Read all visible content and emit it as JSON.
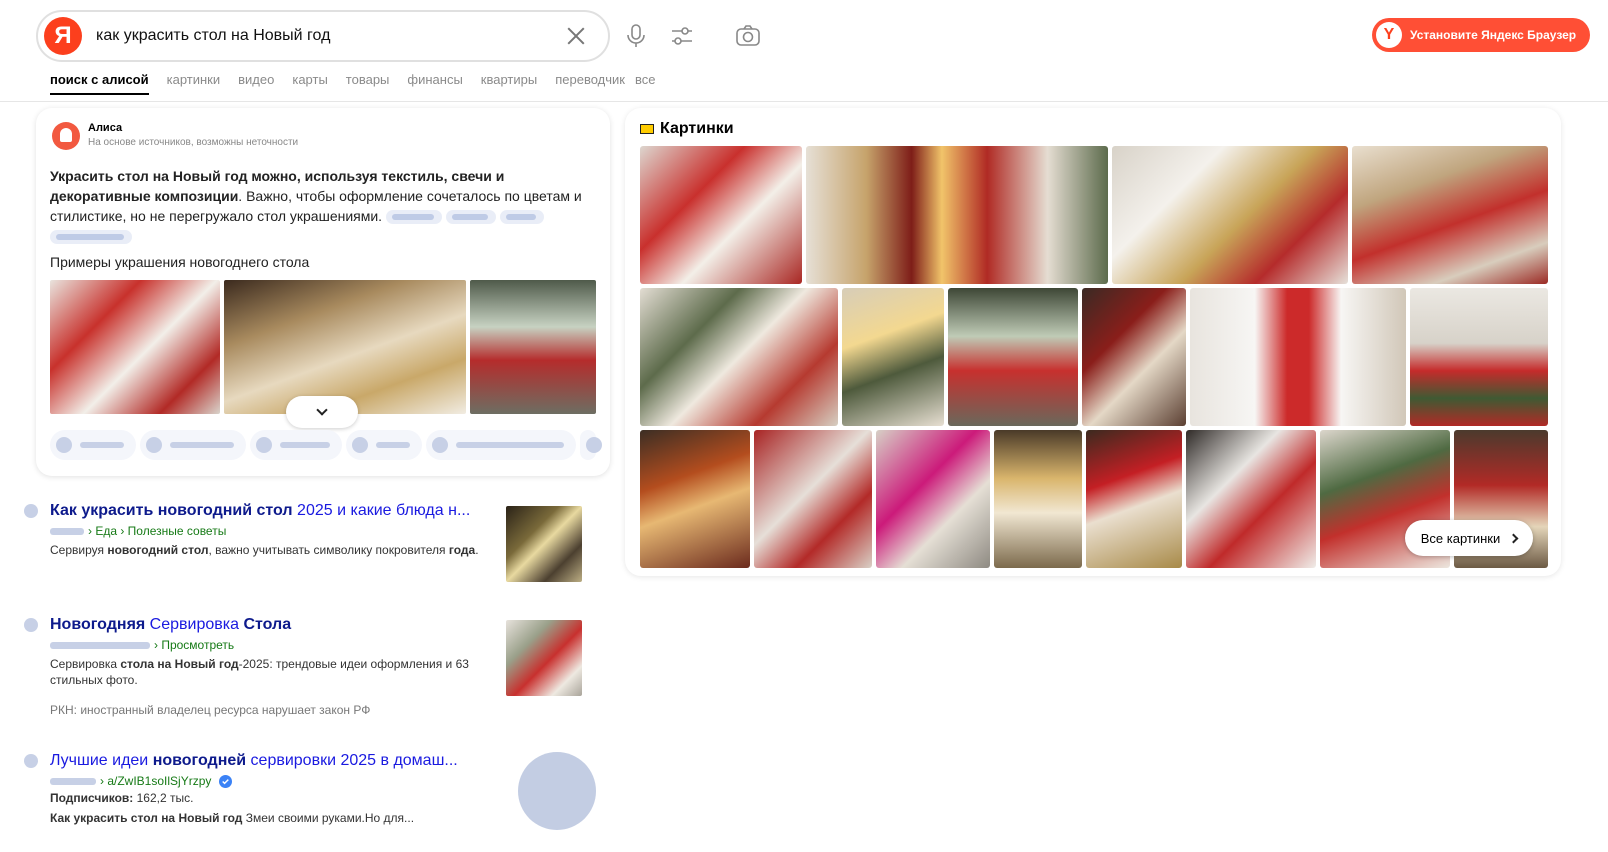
{
  "search": {
    "query": "как украсить стол на Новый год",
    "logo_letter": "Я"
  },
  "header": {
    "install_label": "Установите Яндекс Браузер",
    "install_logo": "Y"
  },
  "tabs": [
    "поиск с алисой",
    "картинки",
    "видео",
    "карты",
    "товары",
    "финансы",
    "квартиры",
    "переводчик",
    "все"
  ],
  "alice": {
    "name": "Алиса",
    "subtitle": "На основе источников, возможны неточности",
    "answer_bold": "Украсить стол на Новый год можно, используя текстиль, свечи и декоративные композиции",
    "answer_rest": ". Важно, чтобы оформление сочеталось по цветам и стилистике, но не перегружало стол украшениями.",
    "examples_title": "Примеры украшения новогоднего стола"
  },
  "results": [
    {
      "title_parts": [
        [
          "b",
          "Как украсить новогодний стол"
        ],
        [
          "t",
          " 2025 и какие блюда н..."
        ]
      ],
      "url": "› Еда › Полезные советы",
      "snippet_parts": [
        [
          "t",
          "Сервируя "
        ],
        [
          "b",
          "новогодний стол"
        ],
        [
          "t",
          ", важно учитывать символику покровителя "
        ],
        [
          "b",
          "года"
        ],
        [
          "t",
          "."
        ]
      ]
    },
    {
      "title_parts": [
        [
          "b",
          "Новогодняя"
        ],
        [
          "t",
          " Сервировка "
        ],
        [
          "b",
          "Стола"
        ]
      ],
      "url": "› Просмотреть",
      "snippet_parts": [
        [
          "t",
          "Сервировка "
        ],
        [
          "b",
          "стола на Новый год"
        ],
        [
          "t",
          "-2025: трендовые идеи оформления и 63 стильных фото."
        ]
      ],
      "note": "РКН: иностранный владелец ресурса нарушает закон РФ"
    },
    {
      "title_parts": [
        [
          "t",
          "Лучшие идеи "
        ],
        [
          "b",
          "новогодней"
        ],
        [
          "t",
          " сервировки 2025 в домаш..."
        ]
      ],
      "url": "› a/ZwIB1soIlSjYrzpy",
      "subscribers_label": "Подписчиков:",
      "subscribers_value": " 162,2 тыс.",
      "snippet_parts": [
        [
          "b",
          "Как украсить стол на Новый год"
        ],
        [
          "t",
          " Змеи своими руками.Но для..."
        ]
      ]
    }
  ],
  "pictures": {
    "title": "Картинки",
    "all_label": "Все картинки"
  },
  "colors": {
    "accent": "#fc3f1d",
    "link": "#1a1ae0",
    "url_green": "#167a16"
  }
}
